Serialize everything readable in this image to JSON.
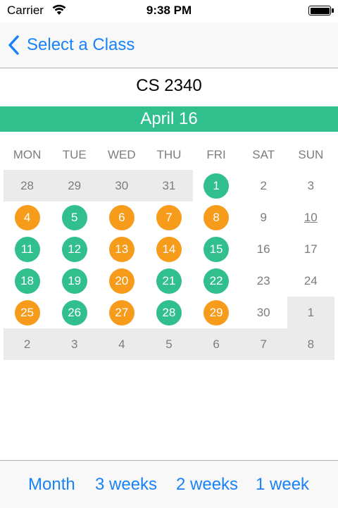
{
  "status": {
    "carrier": "Carrier",
    "time": "9:38 PM"
  },
  "nav": {
    "back_label": "Select a Class"
  },
  "class_title": "CS 2340",
  "month_banner": "April 16",
  "weekdays": [
    "MON",
    "TUE",
    "WED",
    "THU",
    "FRI",
    "SAT",
    "SUN"
  ],
  "colors": {
    "green": "#31bf8e",
    "orange": "#f79b1b",
    "accent": "#1a82f7",
    "gray_cell": "#ebebeb"
  },
  "calendar": {
    "weeks": [
      [
        {
          "day": "28",
          "bg": "gray",
          "mark": ""
        },
        {
          "day": "29",
          "bg": "gray",
          "mark": ""
        },
        {
          "day": "30",
          "bg": "gray",
          "mark": ""
        },
        {
          "day": "31",
          "bg": "gray",
          "mark": ""
        },
        {
          "day": "1",
          "bg": "light",
          "mark": "green"
        },
        {
          "day": "2",
          "bg": "light",
          "mark": ""
        },
        {
          "day": "3",
          "bg": "light",
          "mark": ""
        }
      ],
      [
        {
          "day": "4",
          "bg": "light",
          "mark": "orange"
        },
        {
          "day": "5",
          "bg": "light",
          "mark": "green"
        },
        {
          "day": "6",
          "bg": "light",
          "mark": "orange"
        },
        {
          "day": "7",
          "bg": "light",
          "mark": "orange"
        },
        {
          "day": "8",
          "bg": "light",
          "mark": "orange"
        },
        {
          "day": "9",
          "bg": "light",
          "mark": ""
        },
        {
          "day": "10",
          "bg": "light",
          "mark": "today"
        }
      ],
      [
        {
          "day": "11",
          "bg": "light",
          "mark": "green"
        },
        {
          "day": "12",
          "bg": "light",
          "mark": "green"
        },
        {
          "day": "13",
          "bg": "light",
          "mark": "orange"
        },
        {
          "day": "14",
          "bg": "light",
          "mark": "orange"
        },
        {
          "day": "15",
          "bg": "light",
          "mark": "green"
        },
        {
          "day": "16",
          "bg": "light",
          "mark": ""
        },
        {
          "day": "17",
          "bg": "light",
          "mark": ""
        }
      ],
      [
        {
          "day": "18",
          "bg": "light",
          "mark": "green"
        },
        {
          "day": "19",
          "bg": "light",
          "mark": "green"
        },
        {
          "day": "20",
          "bg": "light",
          "mark": "orange"
        },
        {
          "day": "21",
          "bg": "light",
          "mark": "green"
        },
        {
          "day": "22",
          "bg": "light",
          "mark": "green"
        },
        {
          "day": "23",
          "bg": "light",
          "mark": ""
        },
        {
          "day": "24",
          "bg": "light",
          "mark": ""
        }
      ],
      [
        {
          "day": "25",
          "bg": "light",
          "mark": "orange"
        },
        {
          "day": "26",
          "bg": "light",
          "mark": "green"
        },
        {
          "day": "27",
          "bg": "light",
          "mark": "orange"
        },
        {
          "day": "28",
          "bg": "light",
          "mark": "green"
        },
        {
          "day": "29",
          "bg": "light",
          "mark": "orange"
        },
        {
          "day": "30",
          "bg": "light",
          "mark": ""
        },
        {
          "day": "1",
          "bg": "gray",
          "mark": ""
        }
      ],
      [
        {
          "day": "2",
          "bg": "gray",
          "mark": ""
        },
        {
          "day": "3",
          "bg": "gray",
          "mark": ""
        },
        {
          "day": "4",
          "bg": "gray",
          "mark": ""
        },
        {
          "day": "5",
          "bg": "gray",
          "mark": ""
        },
        {
          "day": "6",
          "bg": "gray",
          "mark": ""
        },
        {
          "day": "7",
          "bg": "gray",
          "mark": ""
        },
        {
          "day": "8",
          "bg": "gray",
          "mark": ""
        }
      ]
    ]
  },
  "toolbar": {
    "month": "Month",
    "three_weeks": "3 weeks",
    "two_weeks": "2 weeks",
    "one_week": "1 week"
  }
}
